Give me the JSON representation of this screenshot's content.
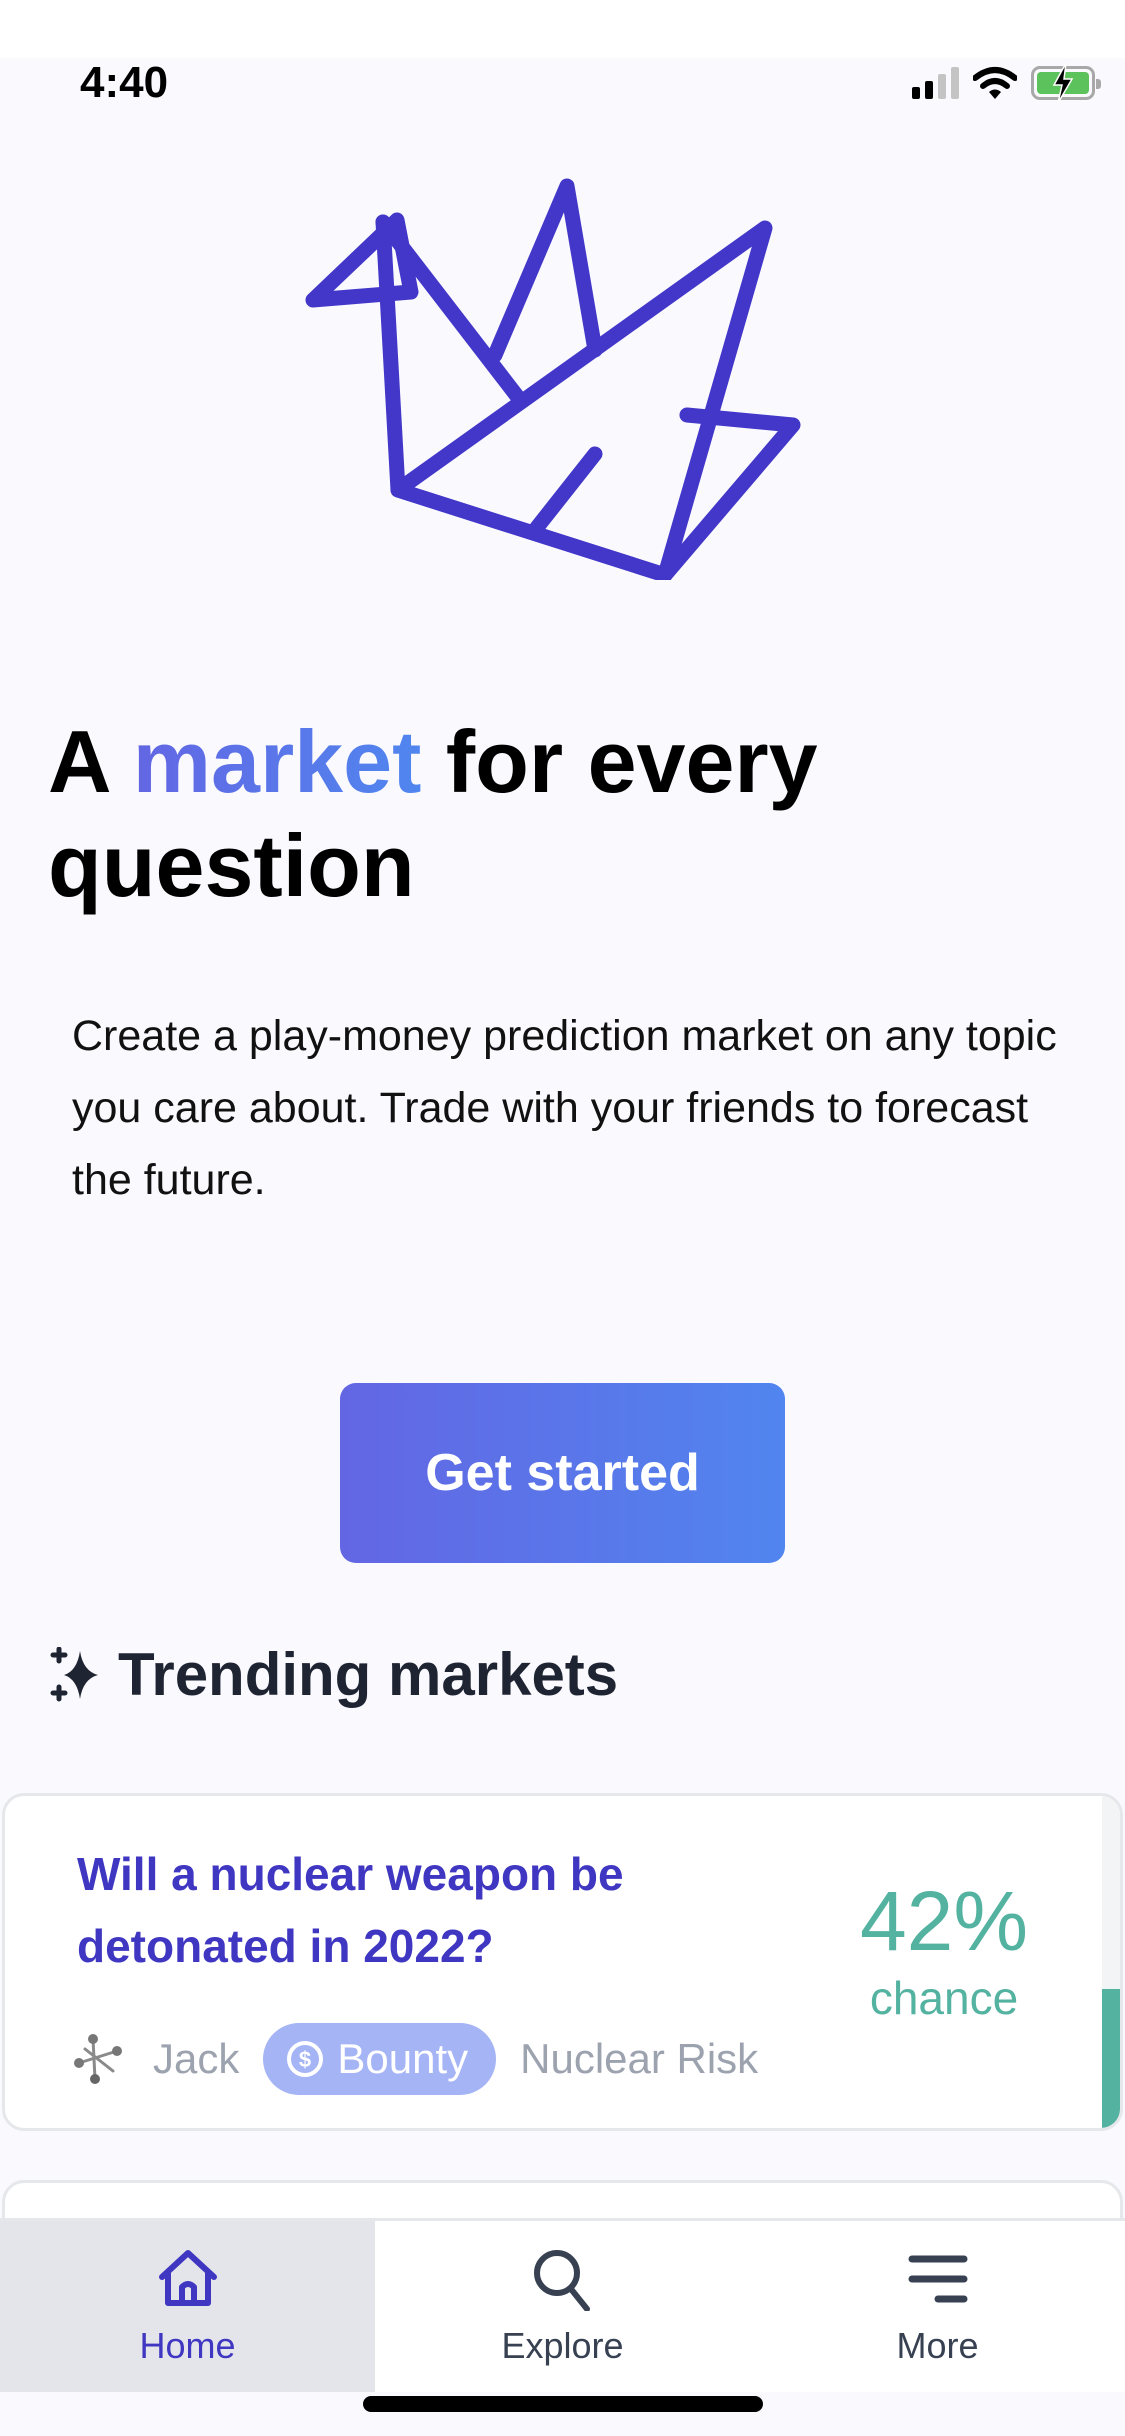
{
  "status_bar": {
    "time": "4:40",
    "signal_bars_active": 2,
    "signal_bars_total": 4,
    "battery_charging": true,
    "battery_color": "#5cc25c"
  },
  "brand": {
    "logo_icon": "origami-crane-icon",
    "logo_color": "#4337c9"
  },
  "hero": {
    "title_prefix": "A",
    "title_accent": "market",
    "title_suffix": "for every question",
    "subtitle": "Create a play-money prediction market on any topic you care about. Trade with your friends to forecast the future.",
    "cta_label": "Get started",
    "accent_gradient": [
      "#6366e3",
      "#5086ef"
    ]
  },
  "trending": {
    "icon": "sparkles-icon",
    "title": "Trending markets",
    "markets": [
      {
        "question": "Will a nuclear weapon be detonated in 2022?",
        "probability": "42%",
        "probability_value": 0.42,
        "probability_label": "chance",
        "creator": "Jack",
        "creator_avatar": "jacks-toy-avatar",
        "badge_icon": "dollar-circle-icon",
        "badge_label": "Bounty",
        "group": "Nuclear Risk",
        "prob_color": "#53b2a0"
      }
    ]
  },
  "tab_bar": {
    "tabs": [
      {
        "label": "Home",
        "icon": "home-icon",
        "active": true
      },
      {
        "label": "Explore",
        "icon": "search-icon",
        "active": false
      },
      {
        "label": "More",
        "icon": "menu-icon",
        "active": false
      }
    ]
  }
}
